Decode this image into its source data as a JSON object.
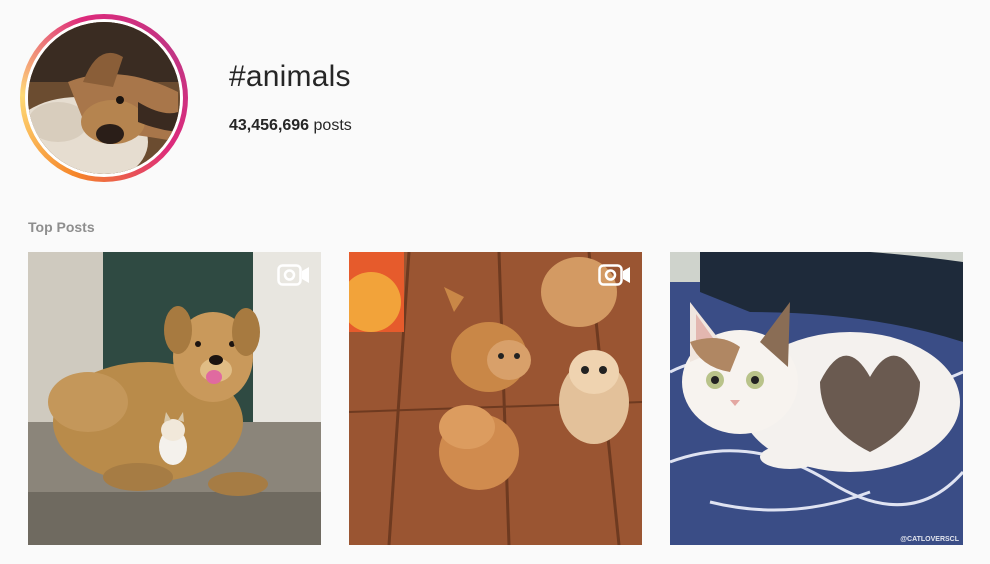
{
  "hashtag": {
    "title": "#animals",
    "post_count": "43,456,696",
    "post_count_suffix": "posts"
  },
  "sections": {
    "top_posts_label": "Top Posts"
  },
  "posts": [
    {
      "subject": "golden retriever with kitten",
      "is_video": true,
      "video_icon": "video-camera-icon"
    },
    {
      "subject": "four fluffy orange kittens on wooden floor",
      "is_video": true,
      "video_icon": "video-camera-icon"
    },
    {
      "subject": "calico kitten with heart-shaped marking",
      "is_video": false,
      "watermark": "@CATLOVERSCL"
    }
  ],
  "colors": {
    "background": "#fafafa",
    "text": "#262626",
    "muted": "#8e8e8e",
    "story_ring_start": "#f58529",
    "story_ring_end": "#dd2a7b"
  }
}
